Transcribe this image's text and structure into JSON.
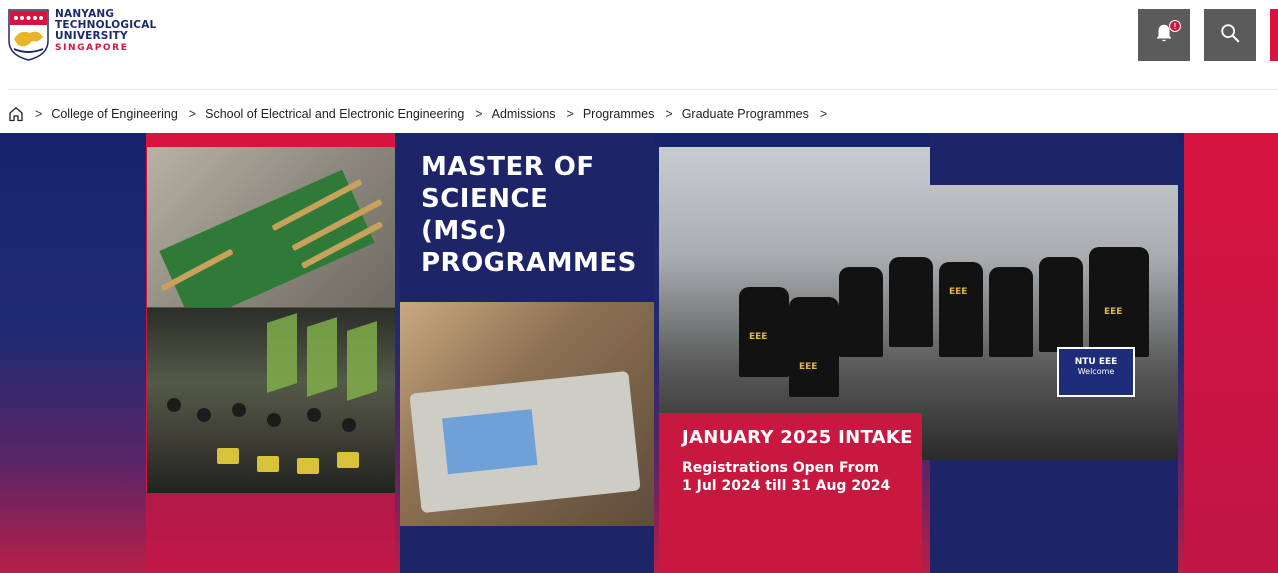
{
  "header": {
    "logo": {
      "line1": "NANYANG",
      "line2": "TECHNOLOGICAL",
      "line3": "UNIVERSITY",
      "line4": "SINGAPORE"
    },
    "notification_badge": "!",
    "icons": [
      "bell-icon",
      "search-icon"
    ]
  },
  "colors": {
    "navy": "#1d2467",
    "red": "#d71440",
    "button_gray": "#5b5b5b"
  },
  "breadcrumb": {
    "separator": ">",
    "items": [
      "College of Engineering",
      "School of Electrical and Electronic Engineering",
      "Admissions",
      "Programmes",
      "Graduate Programmes"
    ]
  },
  "banner": {
    "title_lines": [
      "MASTER OF",
      "SCIENCE",
      "(MSc)",
      "PROGRAMMES"
    ],
    "intake_title": "JANUARY 2025 INTAKE",
    "intake_sub_line1": "Registrations Open From",
    "intake_sub_line2": "1 Jul 2024 till 31 Aug 2024",
    "shirt_text": "EEE",
    "sign_text": "NTU EEE",
    "sign_sub": "Welcome"
  }
}
